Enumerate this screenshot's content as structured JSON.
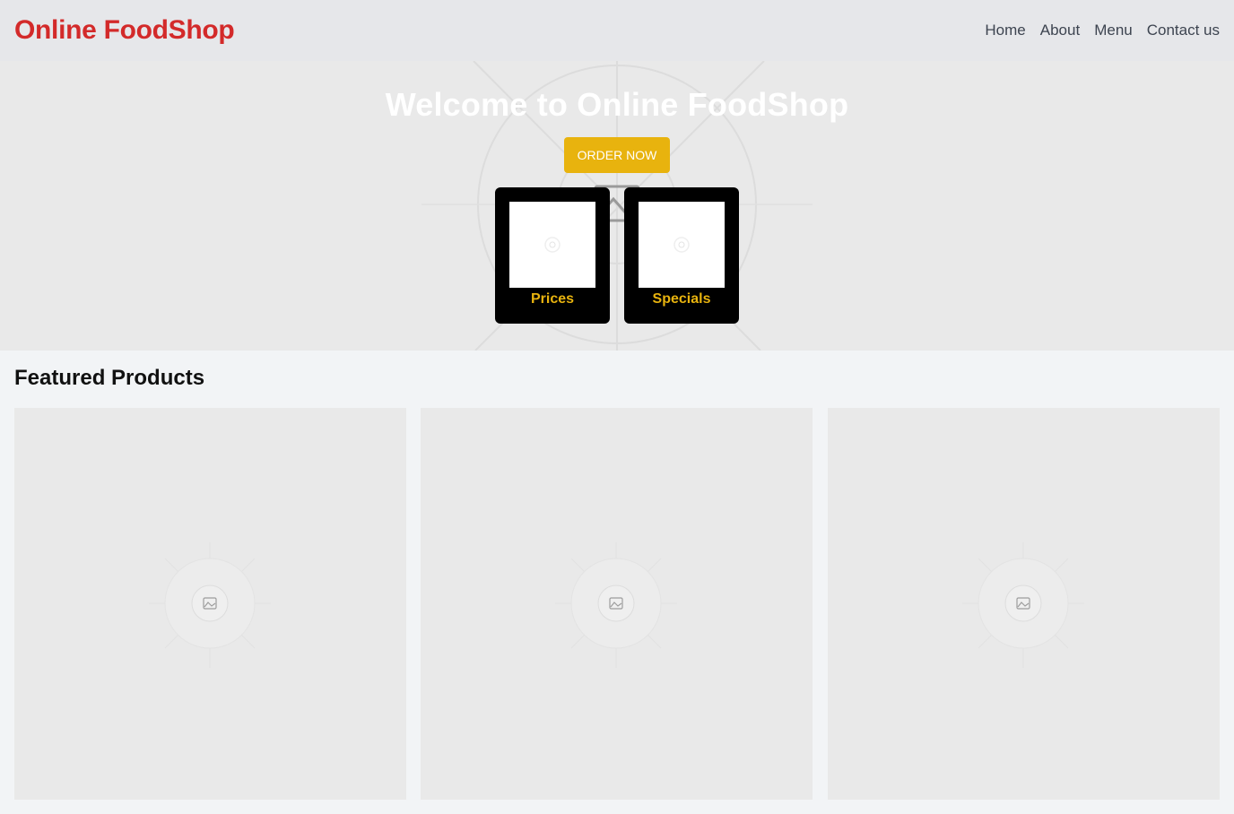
{
  "header": {
    "brand": "Online FoodShop",
    "nav": [
      "Home",
      "About",
      "Menu",
      "Contact us"
    ]
  },
  "hero": {
    "title": "Welcome to Online FoodShop",
    "cta_label": "ORDER NOW",
    "cards": [
      {
        "label": "Prices",
        "icon": "image-placeholder-icon"
      },
      {
        "label": "Specials",
        "icon": "image-placeholder-icon"
      }
    ]
  },
  "featured": {
    "title": "Featured Products",
    "products": [
      {
        "icon": "image-placeholder-icon"
      },
      {
        "icon": "image-placeholder-icon"
      },
      {
        "icon": "image-placeholder-icon"
      }
    ]
  },
  "colors": {
    "brand": "#d32a2a",
    "accent": "#e8b30e",
    "header_bg": "#e6e7ea",
    "page_bg": "#f2f4f6"
  }
}
